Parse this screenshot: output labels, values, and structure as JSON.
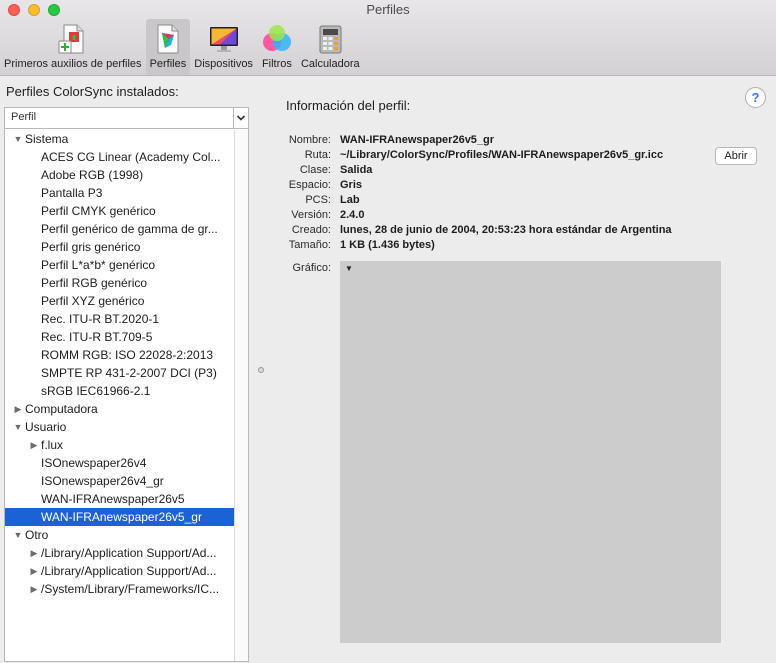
{
  "window": {
    "title": "Perfiles"
  },
  "toolbar": {
    "items": [
      {
        "label": "Primeros auxilios de perfiles",
        "icon": "first-aid-icon",
        "selected": false
      },
      {
        "label": "Perfiles",
        "icon": "profile-icon",
        "selected": true
      },
      {
        "label": "Dispositivos",
        "icon": "monitor-icon",
        "selected": false
      },
      {
        "label": "Filtros",
        "icon": "filters-icon",
        "selected": false
      },
      {
        "label": "Calculadora",
        "icon": "calculator-icon",
        "selected": false
      }
    ]
  },
  "left_panel": {
    "title": "Perfiles ColorSync instalados:",
    "column_header": "Perfil",
    "tree": [
      {
        "label": "Sistema",
        "level": 0,
        "disclosure": "expanded"
      },
      {
        "label": "ACES CG Linear (Academy Col...",
        "level": 1,
        "disclosure": "none"
      },
      {
        "label": "Adobe RGB (1998)",
        "level": 1,
        "disclosure": "none"
      },
      {
        "label": "Pantalla P3",
        "level": 1,
        "disclosure": "none"
      },
      {
        "label": "Perfil CMYK genérico",
        "level": 1,
        "disclosure": "none"
      },
      {
        "label": "Perfil genérico de gamma de gr...",
        "level": 1,
        "disclosure": "none"
      },
      {
        "label": "Perfil gris genérico",
        "level": 1,
        "disclosure": "none"
      },
      {
        "label": "Perfil L*a*b* genérico",
        "level": 1,
        "disclosure": "none"
      },
      {
        "label": "Perfil RGB genérico",
        "level": 1,
        "disclosure": "none"
      },
      {
        "label": "Perfil XYZ genérico",
        "level": 1,
        "disclosure": "none"
      },
      {
        "label": "Rec. ITU-R BT.2020-1",
        "level": 1,
        "disclosure": "none"
      },
      {
        "label": "Rec. ITU-R BT.709-5",
        "level": 1,
        "disclosure": "none"
      },
      {
        "label": "ROMM RGB: ISO 22028-2:2013",
        "level": 1,
        "disclosure": "none"
      },
      {
        "label": "SMPTE RP 431-2-2007 DCI (P3)",
        "level": 1,
        "disclosure": "none"
      },
      {
        "label": "sRGB IEC61966-2.1",
        "level": 1,
        "disclosure": "none"
      },
      {
        "label": "Computadora",
        "level": 0,
        "disclosure": "collapsed"
      },
      {
        "label": "Usuario",
        "level": 0,
        "disclosure": "expanded"
      },
      {
        "label": "f.lux",
        "level": 1,
        "disclosure": "collapsed"
      },
      {
        "label": "ISOnewspaper26v4",
        "level": 1,
        "disclosure": "none"
      },
      {
        "label": "ISOnewspaper26v4_gr",
        "level": 1,
        "disclosure": "none"
      },
      {
        "label": "WAN-IFRAnewspaper26v5",
        "level": 1,
        "disclosure": "none"
      },
      {
        "label": "WAN-IFRAnewspaper26v5_gr",
        "level": 1,
        "disclosure": "none",
        "selected": true
      },
      {
        "label": "Otro",
        "level": 0,
        "disclosure": "expanded"
      },
      {
        "label": "/Library/Application Support/Ad...",
        "level": 1,
        "disclosure": "collapsed"
      },
      {
        "label": "/Library/Application Support/Ad...",
        "level": 1,
        "disclosure": "collapsed"
      },
      {
        "label": "/System/Library/Frameworks/IC...",
        "level": 1,
        "disclosure": "collapsed"
      }
    ]
  },
  "right_panel": {
    "title": "Información del perfil:",
    "help_label": "?",
    "fields": [
      {
        "label": "Nombre:",
        "value": "WAN-IFRAnewspaper26v5_gr"
      },
      {
        "label": "Ruta:",
        "value": "~/Library/ColorSync/Profiles/WAN-IFRAnewspaper26v5_gr.icc"
      },
      {
        "label": "Clase:",
        "value": "Salida"
      },
      {
        "label": "Espacio:",
        "value": "Gris"
      },
      {
        "label": "PCS:",
        "value": "Lab"
      },
      {
        "label": "Versión:",
        "value": "2.4.0"
      },
      {
        "label": "Creado:",
        "value": "lunes, 28 de junio de 2004, 20:53:23 hora estándar de Argentina"
      },
      {
        "label": "Tamaño:",
        "value": "1 KB (1.436 bytes)"
      }
    ],
    "open_button": "Abrir",
    "graph_label": "Gráfico:"
  }
}
